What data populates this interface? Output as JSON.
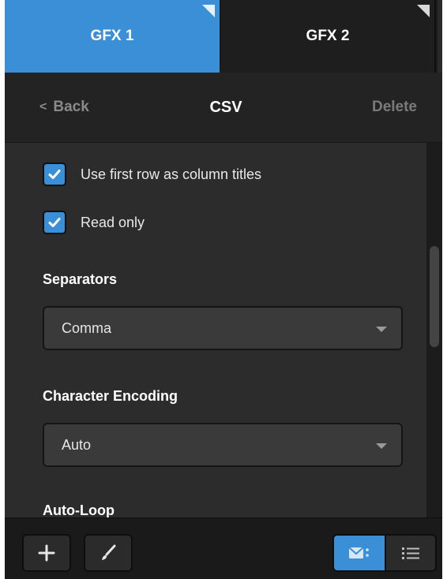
{
  "tabs": [
    {
      "label": "GFX 1",
      "active": true
    },
    {
      "label": "GFX 2",
      "active": false
    }
  ],
  "header": {
    "back_label": "Back",
    "title": "CSV",
    "delete_label": "Delete"
  },
  "options": {
    "first_row_titles": {
      "label": "Use first row as column titles",
      "checked": true
    },
    "read_only": {
      "label": "Read only",
      "checked": true
    }
  },
  "separators": {
    "label": "Separators",
    "selected": "Comma"
  },
  "encoding": {
    "label": "Character Encoding",
    "selected": "Auto"
  },
  "auto_loop": {
    "label": "Auto-Loop"
  },
  "icons": {
    "add": "plus-icon",
    "edit": "brush-icon",
    "layout_tiles": "mail-grid-icon",
    "layout_list": "list-icon",
    "back": "chevron-left-icon",
    "dropdown": "caret-down-icon",
    "check": "checkmark-icon"
  },
  "colors": {
    "accent": "#3b8fd6",
    "panel_bg": "#2c2c2c",
    "header_bg": "#232323"
  }
}
